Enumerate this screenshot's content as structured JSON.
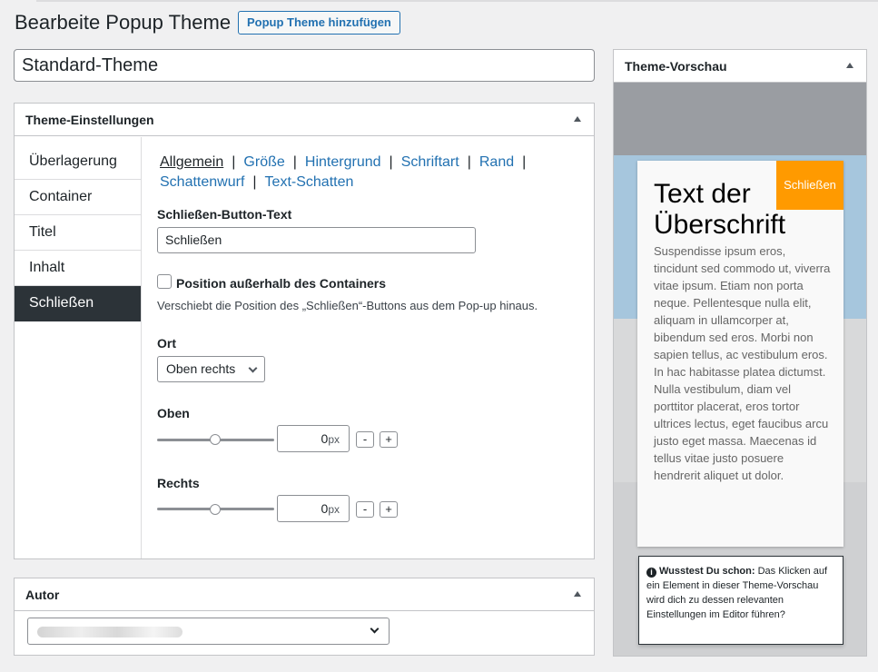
{
  "page": {
    "title": "Bearbeite Popup Theme",
    "add_button": "Popup Theme hinzufügen",
    "theme_name": "Standard-Theme"
  },
  "settings": {
    "heading": "Theme-Einstellungen",
    "vtabs": [
      "Überlagerung",
      "Container",
      "Titel",
      "Inhalt",
      "Schließen"
    ],
    "active_vtab": "Schließen",
    "subtabs": [
      "Allgemein",
      "Größe",
      "Hintergrund",
      "Schriftart",
      "Rand",
      "Schattenwurf",
      "Text-Schatten"
    ],
    "active_subtab": "Allgemein",
    "close_text_label": "Schließen-Button-Text",
    "close_text_value": "Schließen",
    "outside_checkbox_label": "Position außerhalb des Containers",
    "outside_checkbox_checked": false,
    "outside_description": "Verschiebt die Position des „Schließen“-Buttons aus dem Pop-up hinaus.",
    "location_label": "Ort",
    "location_value": "Oben rechts",
    "top_label": "Oben",
    "top_value": "0",
    "top_unit": "px",
    "right_label": "Rechts",
    "right_value": "0",
    "right_unit": "px",
    "minus": "-",
    "plus": "+"
  },
  "author": {
    "heading": "Autor"
  },
  "preview": {
    "heading": "Theme-Vorschau",
    "close_button": "Schließen",
    "popup_title": "Text der Überschrift",
    "popup_body": "Suspendisse ipsum eros, tincidunt sed commodo ut, viverra vitae ipsum. Etiam non porta neque. Pellentesque nulla elit, aliquam in ullamcorper at, bibendum sed eros. Morbi non sapien tellus, ac vestibulum eros. In hac habitasse platea dictumst. Nulla vestibulum, diam vel porttitor placerat, eros tortor ultrices lectus, eget faucibus arcu justo eget massa. Maecenas id tellus vitae justo posuere hendrerit aliquet ut dolor.",
    "tip_bold": "Wusstest Du schon:",
    "tip_text": "Das Klicken auf ein Element in dieser Theme-Vorschau wird dich zu dessen relevanten Einstellungen im Editor führen?"
  },
  "colors": {
    "accent": "#2271b1",
    "active_tab_bg": "#2c3338",
    "close_button_bg": "#ff9a00"
  }
}
